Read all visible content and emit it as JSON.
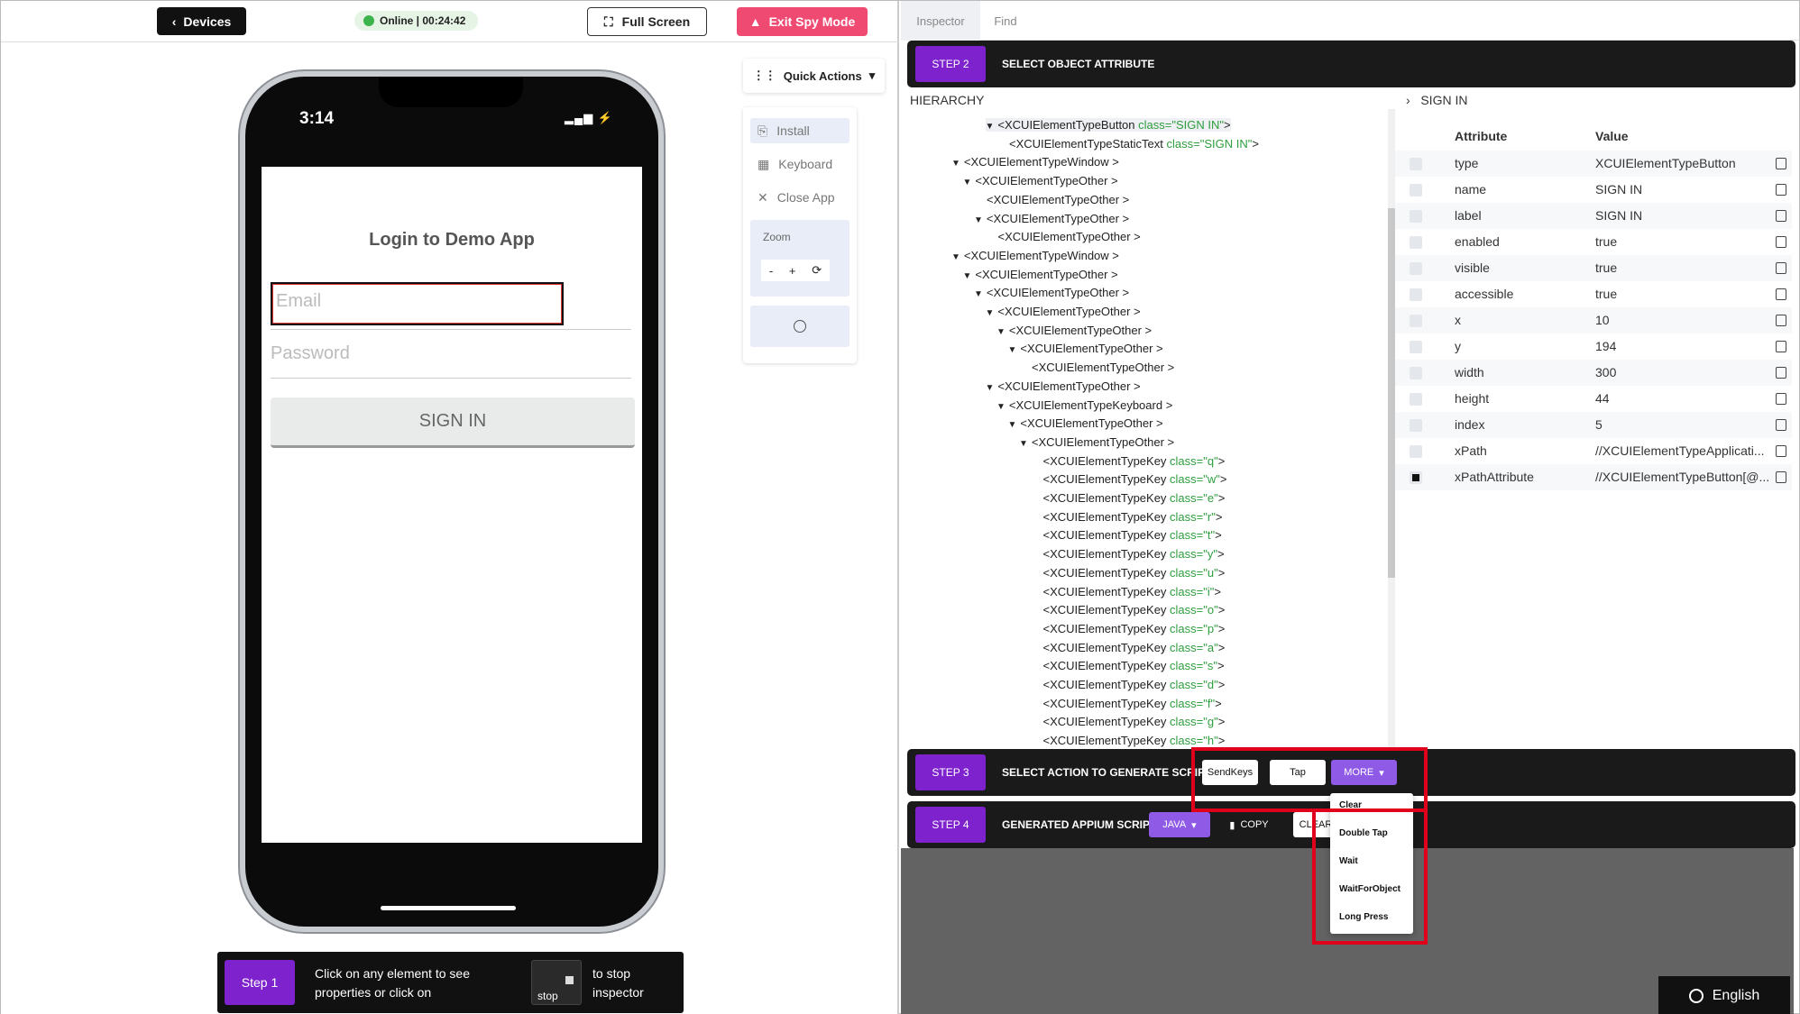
{
  "left_toolbar": {
    "devices_label": "Devices",
    "status_text": "Online | 00:24:42",
    "fullscreen_label": "Full Screen",
    "exit_spy_label": "Exit Spy Mode"
  },
  "phone": {
    "time": "3:14",
    "app_title": "Login to Demo App",
    "email_placeholder": "Email",
    "password_placeholder": "Password",
    "signin_label": "SIGN IN"
  },
  "quick_actions": {
    "label": "Quick Actions",
    "items": [
      "Install",
      "Keyboard",
      "Close App"
    ],
    "zoom_label": "Zoom",
    "zoom_minus": "-",
    "zoom_plus": "+"
  },
  "step1": {
    "badge": "Step 1",
    "text": "Click on any element to see properties or click on",
    "stop_label": "stop",
    "text2": "to stop inspector"
  },
  "tabs": [
    "Inspector",
    "Find"
  ],
  "step2": {
    "badge": "STEP 2",
    "title": "SELECT OBJECT ATTRIBUTE"
  },
  "hierarchy": {
    "heading": "HIERARCHY",
    "nodes": [
      {
        "indent": 7,
        "tri": true,
        "text": "<XCUIElementTypeButton ",
        "cls": "class=\"SIGN IN\"",
        "end": ">"
      },
      {
        "indent": 8,
        "tri": false,
        "text": "<XCUIElementTypeStaticText ",
        "cls": "class=\"SIGN IN\"",
        "end": ">"
      },
      {
        "indent": 4,
        "tri": true,
        "text": "<XCUIElementTypeWindow >",
        "cls": "",
        "end": ""
      },
      {
        "indent": 5,
        "tri": true,
        "text": "<XCUIElementTypeOther >",
        "cls": "",
        "end": ""
      },
      {
        "indent": 6,
        "tri": false,
        "text": "<XCUIElementTypeOther >",
        "cls": "",
        "end": ""
      },
      {
        "indent": 6,
        "tri": true,
        "text": "<XCUIElementTypeOther >",
        "cls": "",
        "end": ""
      },
      {
        "indent": 7,
        "tri": false,
        "text": "<XCUIElementTypeOther >",
        "cls": "",
        "end": ""
      },
      {
        "indent": 4,
        "tri": true,
        "text": "<XCUIElementTypeWindow >",
        "cls": "",
        "end": ""
      },
      {
        "indent": 5,
        "tri": true,
        "text": "<XCUIElementTypeOther >",
        "cls": "",
        "end": ""
      },
      {
        "indent": 6,
        "tri": true,
        "text": "<XCUIElementTypeOther >",
        "cls": "",
        "end": ""
      },
      {
        "indent": 7,
        "tri": true,
        "text": "<XCUIElementTypeOther >",
        "cls": "",
        "end": ""
      },
      {
        "indent": 8,
        "tri": true,
        "text": "<XCUIElementTypeOther >",
        "cls": "",
        "end": ""
      },
      {
        "indent": 9,
        "tri": true,
        "text": "<XCUIElementTypeOther >",
        "cls": "",
        "end": ""
      },
      {
        "indent": 10,
        "tri": false,
        "text": "<XCUIElementTypeOther >",
        "cls": "",
        "end": ""
      },
      {
        "indent": 7,
        "tri": true,
        "text": "<XCUIElementTypeOther >",
        "cls": "",
        "end": ""
      },
      {
        "indent": 8,
        "tri": true,
        "text": "<XCUIElementTypeKeyboard >",
        "cls": "",
        "end": ""
      },
      {
        "indent": 9,
        "tri": true,
        "text": "<XCUIElementTypeOther >",
        "cls": "",
        "end": ""
      },
      {
        "indent": 10,
        "tri": true,
        "text": "<XCUIElementTypeOther >",
        "cls": "",
        "end": ""
      },
      {
        "indent": 11,
        "tri": false,
        "text": "<XCUIElementTypeKey ",
        "cls": "class=\"q\"",
        "end": ">"
      },
      {
        "indent": 11,
        "tri": false,
        "text": "<XCUIElementTypeKey ",
        "cls": "class=\"w\"",
        "end": ">"
      },
      {
        "indent": 11,
        "tri": false,
        "text": "<XCUIElementTypeKey ",
        "cls": "class=\"e\"",
        "end": ">"
      },
      {
        "indent": 11,
        "tri": false,
        "text": "<XCUIElementTypeKey ",
        "cls": "class=\"r\"",
        "end": ">"
      },
      {
        "indent": 11,
        "tri": false,
        "text": "<XCUIElementTypeKey ",
        "cls": "class=\"t\"",
        "end": ">"
      },
      {
        "indent": 11,
        "tri": false,
        "text": "<XCUIElementTypeKey ",
        "cls": "class=\"y\"",
        "end": ">"
      },
      {
        "indent": 11,
        "tri": false,
        "text": "<XCUIElementTypeKey ",
        "cls": "class=\"u\"",
        "end": ">"
      },
      {
        "indent": 11,
        "tri": false,
        "text": "<XCUIElementTypeKey ",
        "cls": "class=\"i\"",
        "end": ">"
      },
      {
        "indent": 11,
        "tri": false,
        "text": "<XCUIElementTypeKey ",
        "cls": "class=\"o\"",
        "end": ">"
      },
      {
        "indent": 11,
        "tri": false,
        "text": "<XCUIElementTypeKey ",
        "cls": "class=\"p\"",
        "end": ">"
      },
      {
        "indent": 11,
        "tri": false,
        "text": "<XCUIElementTypeKey ",
        "cls": "class=\"a\"",
        "end": ">"
      },
      {
        "indent": 11,
        "tri": false,
        "text": "<XCUIElementTypeKey ",
        "cls": "class=\"s\"",
        "end": ">"
      },
      {
        "indent": 11,
        "tri": false,
        "text": "<XCUIElementTypeKey ",
        "cls": "class=\"d\"",
        "end": ">"
      },
      {
        "indent": 11,
        "tri": false,
        "text": "<XCUIElementTypeKey ",
        "cls": "class=\"f\"",
        "end": ">"
      },
      {
        "indent": 11,
        "tri": false,
        "text": "<XCUIElementTypeKey ",
        "cls": "class=\"g\"",
        "end": ">"
      },
      {
        "indent": 11,
        "tri": false,
        "text": "<XCUIElementTypeKey ",
        "cls": "class=\"h\"",
        "end": ">"
      }
    ]
  },
  "attributes": {
    "selected": "SIGN IN",
    "col_attribute": "Attribute",
    "col_value": "Value",
    "rows": [
      {
        "k": "type",
        "v": "XCUIElementTypeButton",
        "checked": false
      },
      {
        "k": "name",
        "v": "SIGN IN",
        "checked": false
      },
      {
        "k": "label",
        "v": "SIGN IN",
        "checked": false
      },
      {
        "k": "enabled",
        "v": "true",
        "checked": false
      },
      {
        "k": "visible",
        "v": "true",
        "checked": false
      },
      {
        "k": "accessible",
        "v": "true",
        "checked": false
      },
      {
        "k": "x",
        "v": "10",
        "checked": false
      },
      {
        "k": "y",
        "v": "194",
        "checked": false
      },
      {
        "k": "width",
        "v": "300",
        "checked": false
      },
      {
        "k": "height",
        "v": "44",
        "checked": false
      },
      {
        "k": "index",
        "v": "5",
        "checked": false
      },
      {
        "k": "xPath",
        "v": "//XCUIElementTypeApplicati...",
        "checked": false
      },
      {
        "k": "xPathAttribute",
        "v": "//XCUIElementTypeButton[@...",
        "checked": true
      }
    ]
  },
  "step3": {
    "badge": "STEP 3",
    "title": "SELECT ACTION TO GENERATE SCRIPT",
    "sendkeys": "SendKeys",
    "tap": "Tap",
    "more": "MORE"
  },
  "more_menu": [
    "Clear",
    "Double Tap",
    "Wait",
    "WaitForObject",
    "Long Press"
  ],
  "step4": {
    "badge": "STEP 4",
    "title": "GENERATED APPIUM SCRIPT",
    "language": "JAVA",
    "copy": "COPY",
    "clear": "CLEAR"
  },
  "language_button": "English",
  "colors": {
    "accent": "#7e22ce",
    "danger": "#ee4a72",
    "online": "#3cb44b",
    "highlight": "#e0001b"
  }
}
